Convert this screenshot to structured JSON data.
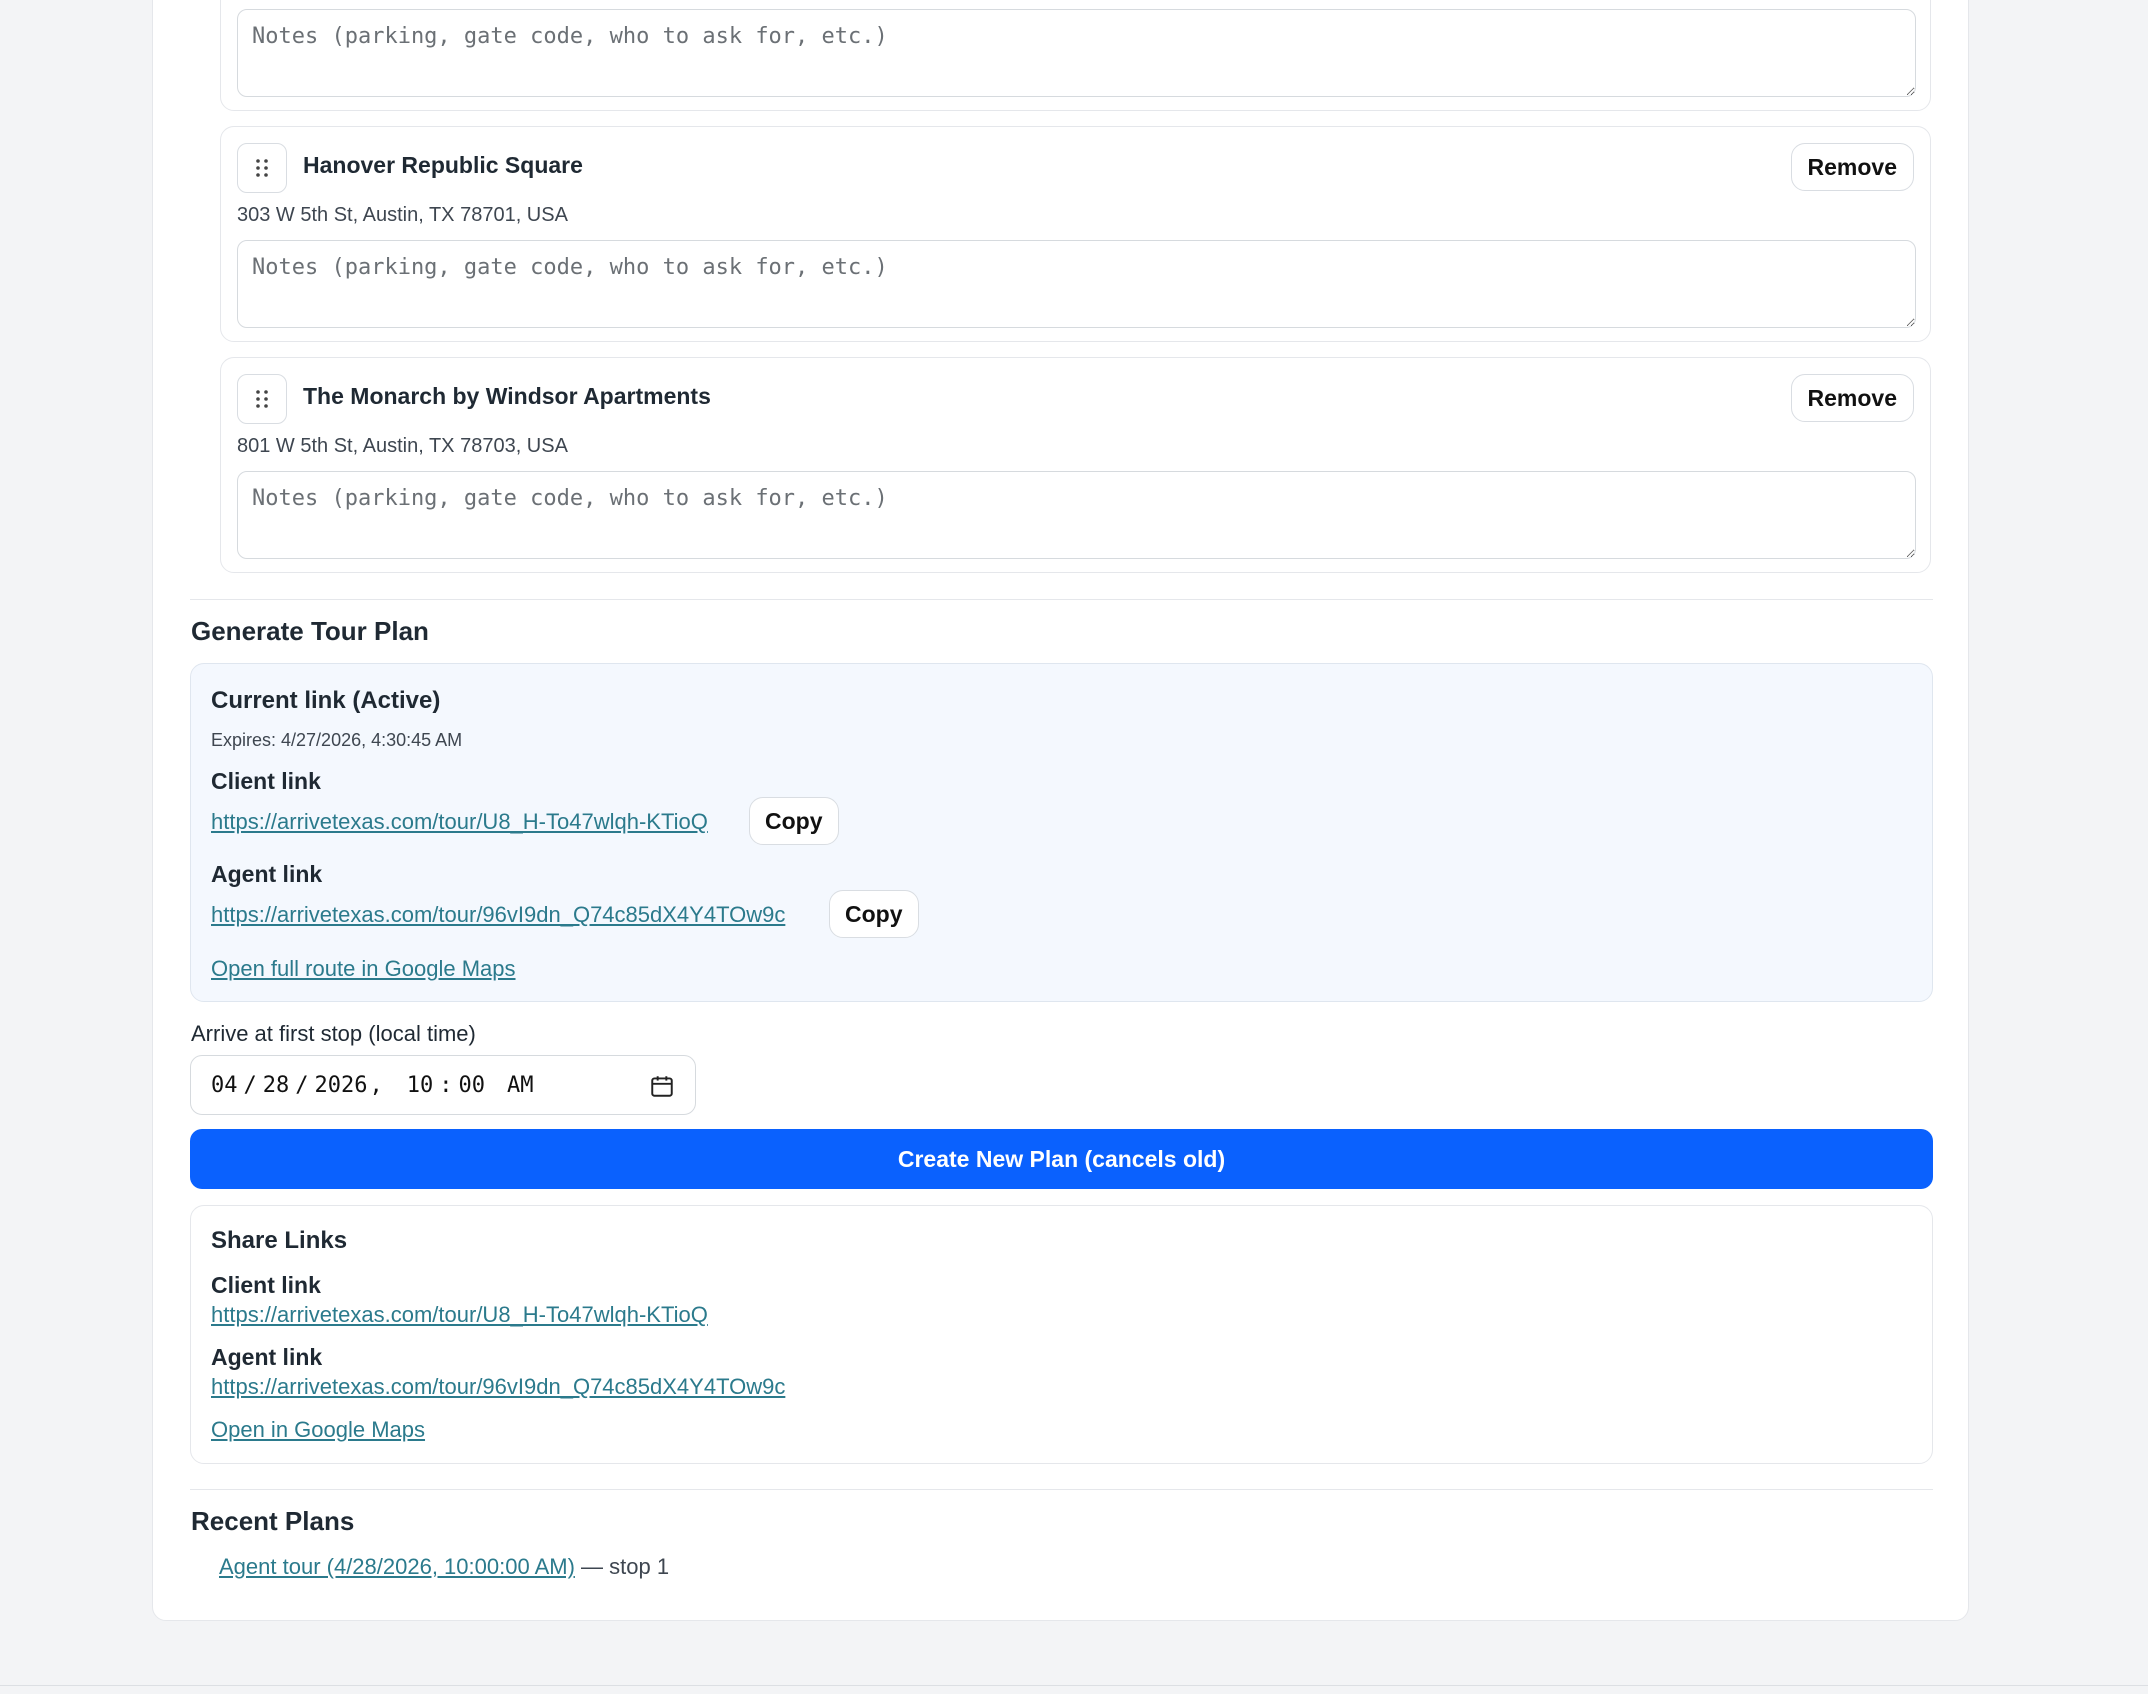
{
  "stops": [
    {
      "name": "",
      "address": "",
      "notes_placeholder": "Notes (parking, gate code, who to ask for, etc.)",
      "notes_value": ""
    },
    {
      "name": "Hanover Republic Square",
      "address": "303 W 5th St, Austin, TX 78701, USA",
      "remove_label": "Remove",
      "notes_placeholder": "Notes (parking, gate code, who to ask for, etc.)",
      "notes_value": ""
    },
    {
      "name": "The Monarch by Windsor Apartments",
      "address": "801 W 5th St, Austin, TX 78703, USA",
      "remove_label": "Remove",
      "notes_placeholder": "Notes (parking, gate code, who to ask for, etc.)",
      "notes_value": ""
    }
  ],
  "generate": {
    "title": "Generate Tour Plan",
    "current": {
      "title": "Current link (Active)",
      "expires": "Expires: 4/27/2026, 4:30:45 AM",
      "client_label": "Client link",
      "client_url": "https://arrivetexas.com/tour/U8_H-To47wlqh-KTioQ",
      "agent_label": "Agent link",
      "agent_url": "https://arrivetexas.com/tour/96vI9dn_Q74c85dX4Y4TOw9c",
      "copy_label": "Copy",
      "maps_link": "Open full route in Google Maps"
    },
    "arrive_label": "Arrive at first stop (local time)",
    "datetime": {
      "month": "04",
      "day": "28",
      "year": "2026",
      "hour": "10",
      "minute": "00",
      "ampm": "AM"
    },
    "create_button": "Create New Plan (cancels old)"
  },
  "share": {
    "title": "Share Links",
    "client_label": "Client link",
    "client_url": "https://arrivetexas.com/tour/U8_H-To47wlqh-KTioQ",
    "agent_label": "Agent link",
    "agent_url": "https://arrivetexas.com/tour/96vI9dn_Q74c85dX4Y4TOw9c",
    "maps_link": "Open in Google Maps"
  },
  "recent": {
    "title": "Recent Plans",
    "items": [
      {
        "link": "Agent tour (4/28/2026, 10:00:00 AM)",
        "suffix": " — stop 1"
      }
    ]
  },
  "colors": {
    "primary": "#0a61fe",
    "link": "#2b7a8c",
    "active_panel_bg": "#f4f8fe",
    "page_bg": "#f3f4f6"
  }
}
